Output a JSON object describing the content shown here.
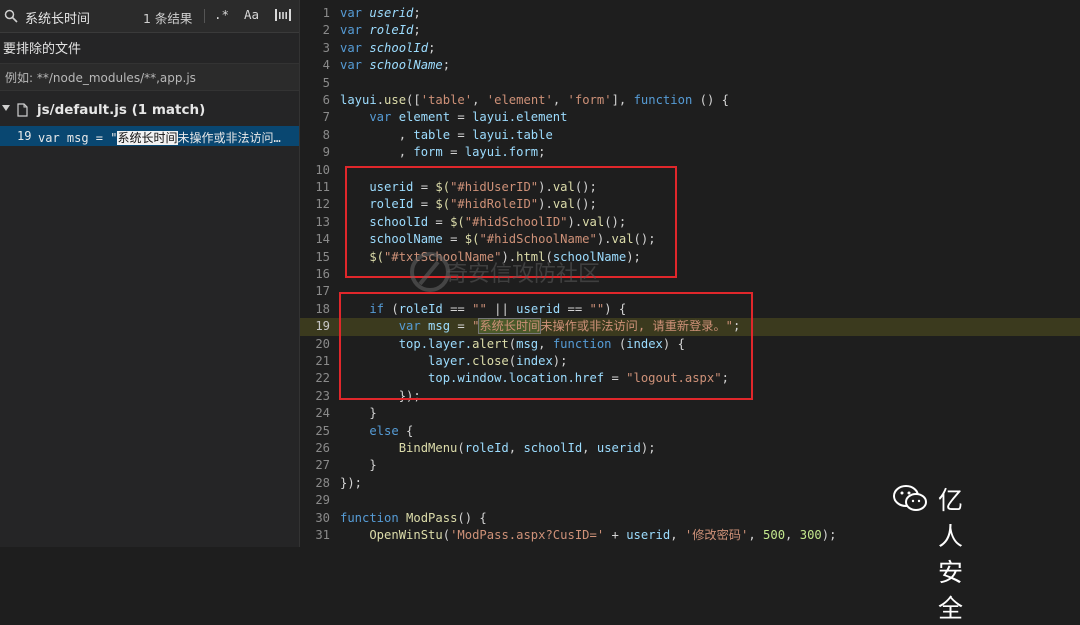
{
  "search": {
    "query": "系统长时间",
    "result_count": "1 条结果",
    "regex_label": ".*",
    "case_label": "Aa",
    "word_label": "|Ш|"
  },
  "exclude": {
    "label": "要排除的文件",
    "placeholder": "例如: **/node_modules/**,app.js"
  },
  "results": {
    "file": "js/default.js (1 match)",
    "match_line": "19",
    "match_prefix": "var msg = \"",
    "match_highlight": "系统长时间",
    "match_suffix": "未操作或非法访问…"
  },
  "editor": {
    "lines": [
      {
        "n": "1"
      },
      {
        "n": "2"
      },
      {
        "n": "3"
      },
      {
        "n": "4"
      },
      {
        "n": "5"
      },
      {
        "n": "6"
      },
      {
        "n": "7"
      },
      {
        "n": "8"
      },
      {
        "n": "9"
      },
      {
        "n": "10"
      },
      {
        "n": "11"
      },
      {
        "n": "12"
      },
      {
        "n": "13"
      },
      {
        "n": "14"
      },
      {
        "n": "15"
      },
      {
        "n": "16"
      },
      {
        "n": "17"
      },
      {
        "n": "18"
      },
      {
        "n": "19"
      },
      {
        "n": "20"
      },
      {
        "n": "21"
      },
      {
        "n": "22"
      },
      {
        "n": "23"
      },
      {
        "n": "24"
      },
      {
        "n": "25"
      },
      {
        "n": "26"
      },
      {
        "n": "27"
      },
      {
        "n": "28"
      },
      {
        "n": "29"
      },
      {
        "n": "30"
      },
      {
        "n": "31"
      }
    ],
    "code": {
      "l1": [
        "var",
        " ",
        "userid",
        ";"
      ],
      "l2": [
        "var",
        " ",
        "roleId",
        ";"
      ],
      "l3": [
        "var",
        " ",
        "schoolId",
        ";"
      ],
      "l4": [
        "var",
        " ",
        "schoolName",
        ";"
      ],
      "l6a": "layui",
      "l6b": ".",
      "l6c": "use",
      "l6d": "([",
      "l6e": "'table'",
      "l6f": ", ",
      "l6g": "'element'",
      "l6h": ", ",
      "l6i": "'form'",
      "l6j": "], ",
      "l6k": "function",
      "l6l": " () {",
      "l7a": "    var",
      "l7b": " element",
      "l7c": " = ",
      "l7d": "layui.element",
      "l8a": "        , ",
      "l8b": "table",
      "l8c": " = ",
      "l8d": "layui.table",
      "l9a": "        , ",
      "l9b": "form",
      "l9c": " = ",
      "l9d": "layui.form",
      "l9e": ";",
      "l11a": "    userid",
      "l11b": " = ",
      "l11c": "$(",
      "l11d": "\"#hidUserID\"",
      "l11e": ").",
      "l11f": "val",
      "l11g": "();",
      "l12a": "    roleId",
      "l12b": " = ",
      "l12c": "$(",
      "l12d": "\"#hidRoleID\"",
      "l12e": ").",
      "l12f": "val",
      "l12g": "();",
      "l13a": "    schoolId",
      "l13b": " = ",
      "l13c": "$(",
      "l13d": "\"#hidSchoolID\"",
      "l13e": ").",
      "l13f": "val",
      "l13g": "();",
      "l14a": "    schoolName",
      "l14b": " = ",
      "l14c": "$(",
      "l14d": "\"#hidSchoolName\"",
      "l14e": ").",
      "l14f": "val",
      "l14g": "();",
      "l15a": "    $(",
      "l15b": "\"#txtSchoolName\"",
      "l15c": ").",
      "l15d": "html",
      "l15e": "(",
      "l15f": "schoolName",
      "l15g": ");",
      "l18a": "    if",
      "l18b": " (",
      "l18c": "roleId",
      "l18d": " == ",
      "l18e": "\"\"",
      "l18f": " || ",
      "l18g": "userid",
      "l18h": " == ",
      "l18i": "\"\"",
      "l18j": ") {",
      "l19a": "        var",
      "l19b": " msg",
      "l19c": " = ",
      "l19d": "\"",
      "l19e": "系统长时间",
      "l19f": "未操作或非法访问, 请重新登录。\"",
      "l19g": ";",
      "l20a": "        top.layer.",
      "l20b": "alert",
      "l20c": "(",
      "l20d": "msg",
      "l20e": ", ",
      "l20f": "function",
      "l20g": " (",
      "l20h": "index",
      "l20i": ") {",
      "l21a": "            layer.",
      "l21b": "close",
      "l21c": "(",
      "l21d": "index",
      "l21e": ");",
      "l22a": "            top.window.location.href",
      "l22b": " = ",
      "l22c": "\"logout.aspx\"",
      "l22d": ";",
      "l23": "        });",
      "l24": "    }",
      "l25a": "    else",
      "l25b": " {",
      "l26a": "        BindMenu",
      "l26b": "(",
      "l26c": "roleId",
      "l26d": ", ",
      "l26e": "schoolId",
      "l26f": ", ",
      "l26g": "userid",
      "l26h": ");",
      "l27": "    }",
      "l28": "});",
      "l30a": "function",
      "l30b": " ModPass",
      "l30c": "() {",
      "l31a": "    OpenWinStu",
      "l31b": "(",
      "l31c": "'ModPass.aspx?CusID='",
      "l31d": " + ",
      "l31e": "userid",
      "l31f": ", ",
      "l31g": "'修改密码'",
      "l31h": ", ",
      "l31i": "500",
      "l31j": ", ",
      "l31k": "300",
      "l31l": ");"
    }
  },
  "watermark": "奇安信攻防社区",
  "brand": "亿人安全",
  "colors": {
    "accent_selection": "#094771",
    "annotation_red": "#e0272b",
    "keyword": "#569cd6",
    "string": "#ce9178",
    "function": "#dcdcaa"
  }
}
